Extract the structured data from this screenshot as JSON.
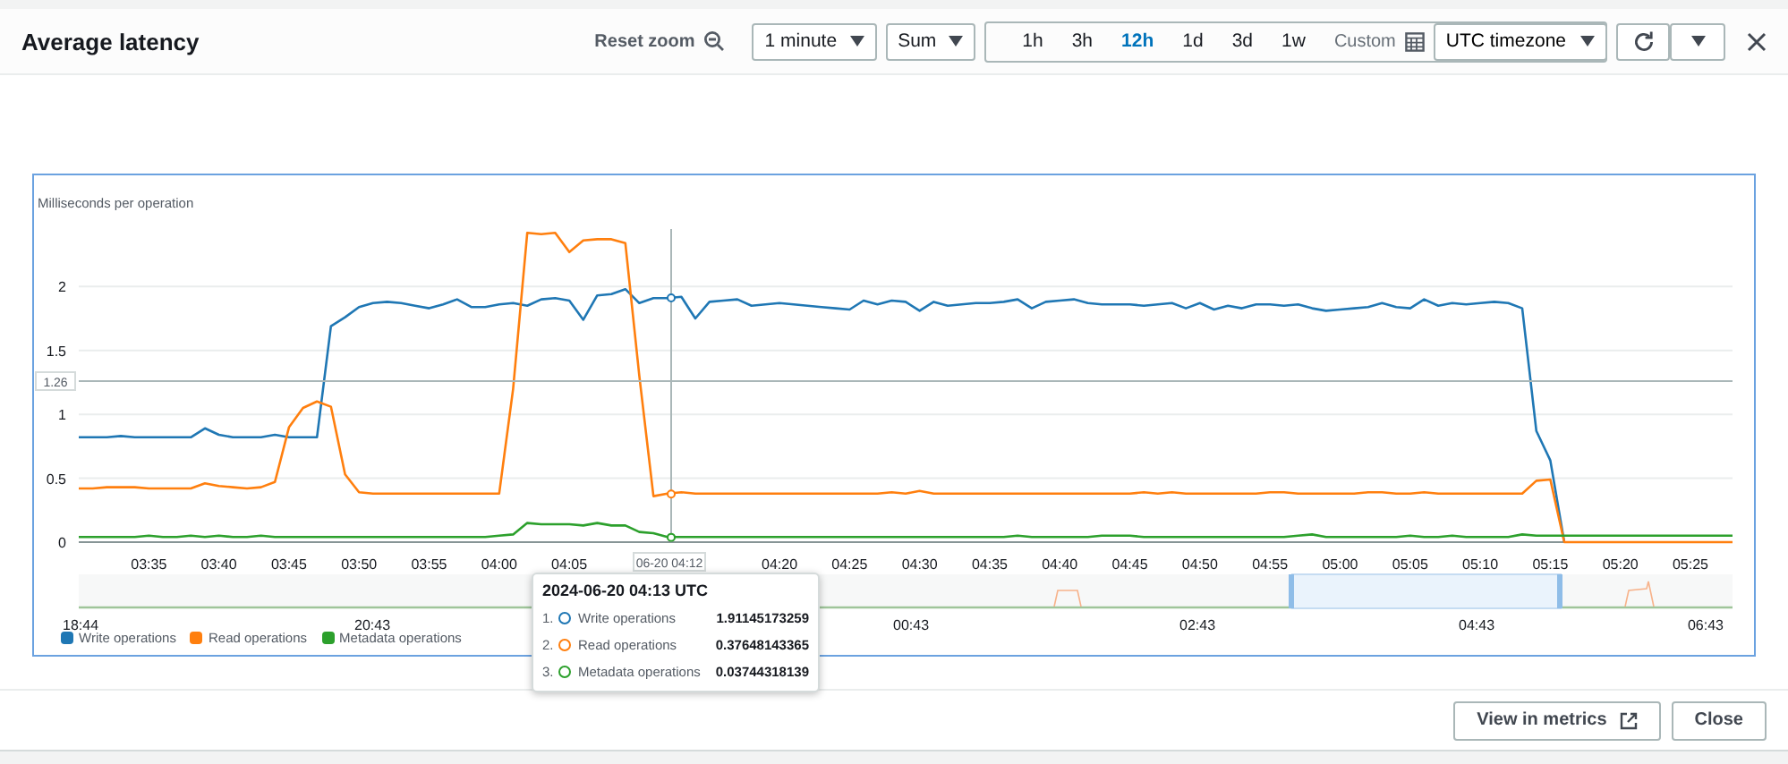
{
  "title": "Average latency",
  "toolbar": {
    "reset_zoom": "Reset zoom",
    "period": "1 minute",
    "statistic": "Sum",
    "ranges": [
      {
        "label": "1h",
        "selected": false
      },
      {
        "label": "3h",
        "selected": false
      },
      {
        "label": "12h",
        "selected": true
      },
      {
        "label": "1d",
        "selected": false
      },
      {
        "label": "3d",
        "selected": false
      },
      {
        "label": "1w",
        "selected": false
      }
    ],
    "custom": "Custom",
    "timezone": "UTC timezone"
  },
  "chart": {
    "crosshair_time": "06-20 04:12",
    "chart_data": {
      "type": "line",
      "ylabel": "Milliseconds per operation",
      "categories": [
        null,
        null,
        null,
        null,
        null,
        "03:35",
        null,
        null,
        null,
        null,
        "03:40",
        null,
        null,
        null,
        null,
        "03:45",
        null,
        null,
        null,
        null,
        "03:50",
        null,
        null,
        null,
        null,
        "03:55",
        null,
        null,
        null,
        null,
        "04:00",
        null,
        null,
        null,
        null,
        "04:05",
        null,
        null,
        null,
        null,
        null,
        null,
        null,
        null,
        null,
        null,
        null,
        null,
        null,
        null,
        "04:20",
        null,
        null,
        null,
        null,
        "04:25",
        null,
        null,
        null,
        null,
        "04:30",
        null,
        null,
        null,
        null,
        "04:35",
        null,
        null,
        null,
        null,
        "04:40",
        null,
        null,
        null,
        null,
        "04:45",
        null,
        null,
        null,
        null,
        "04:50",
        null,
        null,
        null,
        null,
        "04:55",
        null,
        null,
        null,
        null,
        "05:00",
        null,
        null,
        null,
        null,
        "05:05",
        null,
        null,
        null,
        null,
        "05:10",
        null,
        null,
        null,
        null,
        "05:15",
        null,
        null,
        null,
        null,
        "05:20",
        null,
        null,
        null,
        null,
        "05:25",
        null,
        null,
        null
      ],
      "series": [
        {
          "name": "Write operations",
          "color": "#1f77b4",
          "values": [
            0.82,
            0.82,
            0.82,
            0.83,
            0.82,
            0.82,
            0.82,
            0.82,
            0.82,
            0.89,
            0.84,
            0.82,
            0.82,
            0.82,
            0.84,
            0.82,
            0.82,
            0.82,
            1.69,
            1.76,
            1.84,
            1.87,
            1.88,
            1.87,
            1.85,
            1.83,
            1.86,
            1.9,
            1.84,
            1.84,
            1.86,
            1.87,
            1.85,
            1.9,
            1.91,
            1.89,
            1.74,
            1.93,
            1.94,
            1.98,
            1.87,
            1.91,
            1.91,
            1.92,
            1.75,
            1.88,
            1.89,
            1.9,
            1.85,
            1.86,
            1.87,
            1.86,
            1.85,
            1.84,
            1.83,
            1.82,
            1.89,
            1.86,
            1.89,
            1.88,
            1.81,
            1.88,
            1.85,
            1.86,
            1.87,
            1.87,
            1.88,
            1.9,
            1.83,
            1.88,
            1.89,
            1.9,
            1.87,
            1.86,
            1.86,
            1.86,
            1.85,
            1.86,
            1.87,
            1.83,
            1.87,
            1.82,
            1.85,
            1.83,
            1.86,
            1.86,
            1.85,
            1.86,
            1.83,
            1.81,
            1.82,
            1.83,
            1.84,
            1.87,
            1.84,
            1.83,
            1.9,
            1.85,
            1.87,
            1.86,
            1.87,
            1.88,
            1.87,
            1.83,
            0.87,
            0.64,
            0,
            null,
            null,
            null,
            null,
            null,
            null,
            null,
            null,
            null,
            null,
            null,
            null
          ]
        },
        {
          "name": "Read operations",
          "color": "#ff7f0e",
          "values": [
            0.42,
            0.42,
            0.43,
            0.43,
            0.43,
            0.42,
            0.42,
            0.42,
            0.42,
            0.46,
            0.44,
            0.43,
            0.42,
            0.43,
            0.47,
            0.9,
            1.05,
            1.1,
            1.06,
            0.53,
            0.39,
            0.38,
            0.38,
            0.38,
            0.38,
            0.38,
            0.38,
            0.38,
            0.38,
            0.38,
            0.38,
            1.2,
            2.42,
            2.41,
            2.42,
            2.27,
            2.36,
            2.37,
            2.37,
            2.34,
            1.3,
            0.36,
            0.38,
            0.39,
            0.38,
            0.38,
            0.38,
            0.38,
            0.38,
            0.38,
            0.38,
            0.38,
            0.38,
            0.38,
            0.38,
            0.38,
            0.38,
            0.38,
            0.39,
            0.38,
            0.4,
            0.38,
            0.38,
            0.38,
            0.38,
            0.38,
            0.38,
            0.38,
            0.38,
            0.38,
            0.38,
            0.38,
            0.38,
            0.38,
            0.38,
            0.38,
            0.39,
            0.38,
            0.39,
            0.38,
            0.38,
            0.38,
            0.38,
            0.38,
            0.38,
            0.39,
            0.39,
            0.38,
            0.38,
            0.38,
            0.38,
            0.38,
            0.39,
            0.39,
            0.38,
            0.38,
            0.39,
            0.38,
            0.38,
            0.38,
            0.38,
            0.38,
            0.38,
            0.38,
            0.48,
            0.49,
            0,
            0,
            0,
            0,
            0,
            0,
            0,
            0,
            0,
            0,
            0,
            0,
            0
          ]
        },
        {
          "name": "Metadata operations",
          "color": "#2ca02c",
          "values": [
            0.04,
            0.04,
            0.04,
            0.04,
            0.04,
            0.05,
            0.04,
            0.04,
            0.05,
            0.04,
            0.05,
            0.04,
            0.04,
            0.05,
            0.04,
            0.04,
            0.04,
            0.04,
            0.04,
            0.04,
            0.04,
            0.04,
            0.04,
            0.04,
            0.04,
            0.04,
            0.04,
            0.04,
            0.04,
            0.04,
            0.05,
            0.06,
            0.15,
            0.14,
            0.14,
            0.14,
            0.13,
            0.15,
            0.13,
            0.13,
            0.08,
            0.07,
            0.04,
            0.04,
            0.04,
            0.04,
            0.04,
            0.04,
            0.04,
            0.04,
            0.04,
            0.04,
            0.04,
            0.04,
            0.04,
            0.04,
            0.04,
            0.04,
            0.04,
            0.04,
            0.04,
            0.04,
            0.04,
            0.04,
            0.04,
            0.04,
            0.04,
            0.05,
            0.04,
            0.04,
            0.04,
            0.04,
            0.04,
            0.05,
            0.05,
            0.05,
            0.04,
            0.04,
            0.04,
            0.04,
            0.04,
            0.04,
            0.04,
            0.04,
            0.04,
            0.04,
            0.04,
            0.05,
            0.06,
            0.04,
            0.04,
            0.04,
            0.04,
            0.04,
            0.04,
            0.05,
            0.04,
            0.04,
            0.05,
            0.04,
            0.04,
            0.04,
            0.04,
            0.06,
            0.05,
            0.05,
            0.05,
            0.05,
            0.05,
            0.05,
            0.05,
            0.05,
            0.05,
            0.05,
            0.05,
            0.05,
            0.05,
            0.05,
            0.05
          ]
        }
      ],
      "ylim": [
        0,
        2.45
      ],
      "grid": true,
      "ref_lines": [
        {
          "axis": "y",
          "value": 1.26,
          "label": "1.26"
        }
      ],
      "yticks": [
        0,
        {
          "value": 0.5,
          "label": "0.5"
        },
        1,
        {
          "value": 1.5,
          "label": "1.5"
        },
        2
      ]
    },
    "navigator_labels": [
      "18:44",
      "20:43",
      "00:43",
      "02:43",
      "04:43",
      "06:43"
    ],
    "tooltip": {
      "title": "2024-06-20 04:13 UTC",
      "rows": [
        {
          "index": "1.",
          "name": "Write operations",
          "value": "1.91145173259",
          "color": "#1f77b4"
        },
        {
          "index": "2.",
          "name": "Read operations",
          "value": "0.37648143365",
          "color": "#ff7f0e"
        },
        {
          "index": "3.",
          "name": "Metadata operations",
          "value": "0.03744318139",
          "color": "#2ca02c"
        }
      ]
    }
  },
  "buttons": [
    "View in metrics",
    "Close"
  ]
}
